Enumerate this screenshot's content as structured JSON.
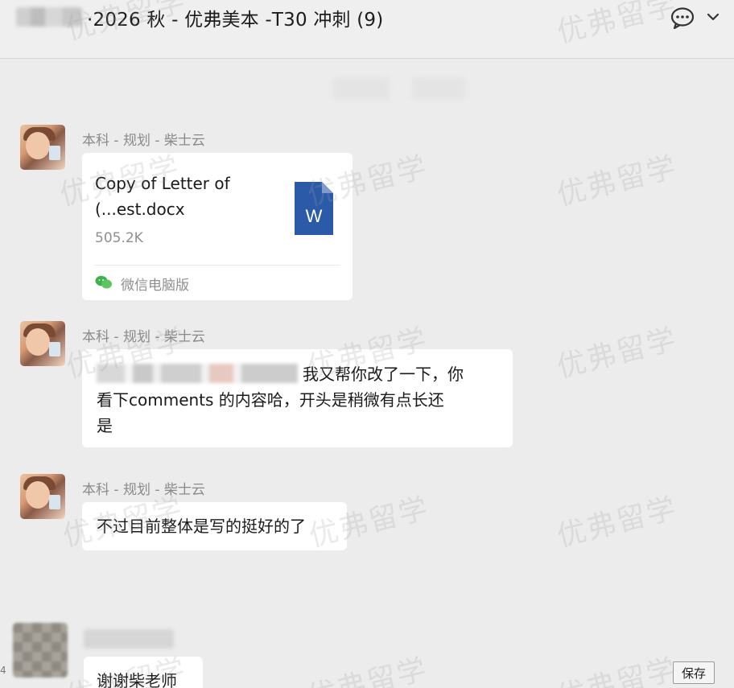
{
  "header": {
    "title": "·2026 秋 - 优弗美本 -T30 冲刺 (9)",
    "icons": [
      "chat-bubble-icon",
      "chevron-down-icon"
    ]
  },
  "messages": [
    {
      "sender": "本科 - 规划 - 柴士云",
      "type": "file",
      "file": {
        "name_line1": "Copy of Letter of",
        "name_line2": "(...est.docx",
        "size": "505.2K",
        "source": "微信电脑版",
        "icon_letter": "W",
        "icon_color": "#2b579a"
      }
    },
    {
      "sender": "本科 - 规划 - 柴士云",
      "type": "text",
      "text_line1": "我又帮你改了一下，你",
      "text_line2": "看下comments 的内容哈，开头是稍微有点长还",
      "text_line3": "是"
    },
    {
      "sender": "本科 - 规划 - 柴士云",
      "type": "text",
      "text": "不过目前整体是写的挺好的了"
    },
    {
      "type": "text",
      "text": "谢谢柴老师"
    }
  ],
  "watermark": "优弗留学",
  "save_button": "保存",
  "edge_mark": "4"
}
